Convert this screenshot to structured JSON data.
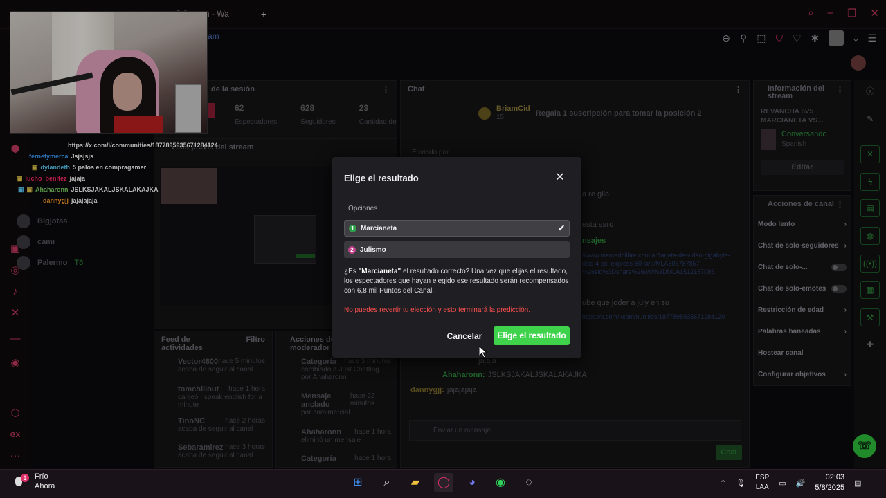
{
  "browser": {
    "tab_title": "es5 Stream - Wa",
    "tab2_fragment": "am"
  },
  "webcam_overlay": {
    "link_text": "https://x.com/i/communities/1877895935671284124",
    "chat_lines": [
      {
        "user": "fernetymerca",
        "message": "Jsjsjsjs",
        "color": "#3da0ff"
      },
      {
        "user": "dylandeth",
        "message": "5 palos en compragamer",
        "color": "#5fd3ff"
      },
      {
        "user": "lucho_benitez",
        "message": "jajaja",
        "color": "#ff2b6a"
      },
      {
        "user": "Ahaharonn",
        "message": "JSLKSJAKALJSKALAKAJKA",
        "color": "#7fd36a"
      },
      {
        "user": "dannygjj",
        "message": "jajajajaja",
        "color": "#ff9d2b"
      }
    ]
  },
  "sidebar_users": [
    {
      "name": "Bigjotaa",
      "extra": ""
    },
    {
      "name": "cami",
      "extra": ""
    },
    {
      "name": "Palermo",
      "extra": "T6"
    }
  ],
  "session": {
    "title": "de la sesión",
    "stats": [
      {
        "value": "62",
        "label": "Espectadores"
      },
      {
        "value": "628",
        "label": "Seguidores"
      },
      {
        "value": "23",
        "label": "Cantidad de"
      }
    ],
    "preview_title": "Vista previa del stream"
  },
  "chat": {
    "title": "Chat",
    "top_user": "BriamCid",
    "top_count": "15",
    "promo": "Regala 1 suscripción para tomar la posición 2",
    "sent_by": "Enviado por",
    "snippets": [
      "a re glia",
      "esta saro",
      "nsajes",
      "ube que joder a july en su"
    ],
    "links": [
      "//www.mercadolibre.com.ar/tarjeta-de-video-gigabyte-",
      "dlss-4-pci-express-50-la/p/MLA503787857",
      "%26sid%3Dshare%26wid%3DMLA1512157085",
      "https://x.com/i/communities/1877895935671284120"
    ],
    "bottom_lines": [
      {
        "user": "",
        "message": "jajaja"
      },
      {
        "user": "Ahaharonn:",
        "message": "JSLKSJAKALJSKALAKAJKA"
      },
      {
        "user": "dannygjj:",
        "message": "jajajajaja"
      }
    ],
    "input_placeholder": "Enviar un mensaje",
    "send_label": "Chat"
  },
  "activity": {
    "feed_title": "Feed de actividades",
    "filter_label": "Filtro",
    "items": [
      {
        "name": "Vector4800",
        "time": "hace 5 minutos",
        "desc": "acaba de seguir al canal"
      },
      {
        "name": "tomchillout",
        "time": "hace 1 hora",
        "desc": "canjeó I speak english for a minute"
      },
      {
        "name": "TinoNC",
        "time": "hace 2 horas",
        "desc": "acaba de seguir al canal"
      },
      {
        "name": "Sebaramirez",
        "time": "hace 3 horas",
        "desc": "acaba de seguir al canal"
      }
    ]
  },
  "mod_actions": {
    "title": "Acciones de moderador",
    "items": [
      {
        "label": "Categoría",
        "time": "hace 3 minutos",
        "desc": "cambiado a Just Chatting por Ahaharonn"
      },
      {
        "label": "Mensaje anclado",
        "time": "hace 22 minutos",
        "desc": "por comimercial"
      },
      {
        "label": "Ahaharonn",
        "time": "hace 1 hora",
        "desc": "eliminó un mensaje"
      },
      {
        "label": "Categoría",
        "time": "hace 1 hora",
        "desc": ""
      }
    ]
  },
  "stream_info": {
    "title": "Información del stream",
    "stream_title": "REVANCHA 5V5 MARCIANETA VS...",
    "category": "Conversando",
    "language": "Spanish",
    "edit_label": "Editar"
  },
  "channel_actions": {
    "title": "Acciones de canal",
    "items": [
      {
        "label": "Modo lento",
        "control": "arrow"
      },
      {
        "label": "Chat de solo-seguidores",
        "control": "arrow"
      },
      {
        "label": "Chat de solo-...",
        "control": "toggle"
      },
      {
        "label": "Chat de solo-emotes",
        "control": "toggle"
      },
      {
        "label": "Restricción de edad",
        "control": "arrow"
      },
      {
        "label": "Palabras baneadas",
        "control": "arrow"
      },
      {
        "label": "Hostear canal",
        "control": "none"
      },
      {
        "label": "Configurar objetivos",
        "control": "arrow"
      }
    ]
  },
  "modal": {
    "title": "Elige el resultado",
    "options_label": "Opciones",
    "options": [
      {
        "num": "1",
        "label": "Marcianeta",
        "selected": true,
        "color": "#2f9e4a"
      },
      {
        "num": "2",
        "label": "Julismo",
        "selected": false,
        "color": "#c2418a"
      }
    ],
    "question_prefix": "¿Es ",
    "question_choice": "\"Marcianeta\"",
    "question_suffix": " el resultado correcto? Una vez que elijas el resultado, los espectadores que hayan elegido ese resultado serán recompensados con 6,8 mil Puntos del Canal.",
    "warning": "No puedes revertir tu elección y esto terminará la predicción.",
    "cancel_label": "Cancelar",
    "confirm_label": "Elige el resultado"
  },
  "taskbar": {
    "weather_title": "Frío",
    "weather_sub": "Ahora",
    "lang": "ESP",
    "lang_sub": "LAA",
    "time": "02:03",
    "date": "5/8/2025",
    "notif_badge": "1"
  },
  "colors": {
    "accent_green": "#3fd34b",
    "opera_red": "#c33a5f",
    "warning_red": "#ff4f4f"
  }
}
